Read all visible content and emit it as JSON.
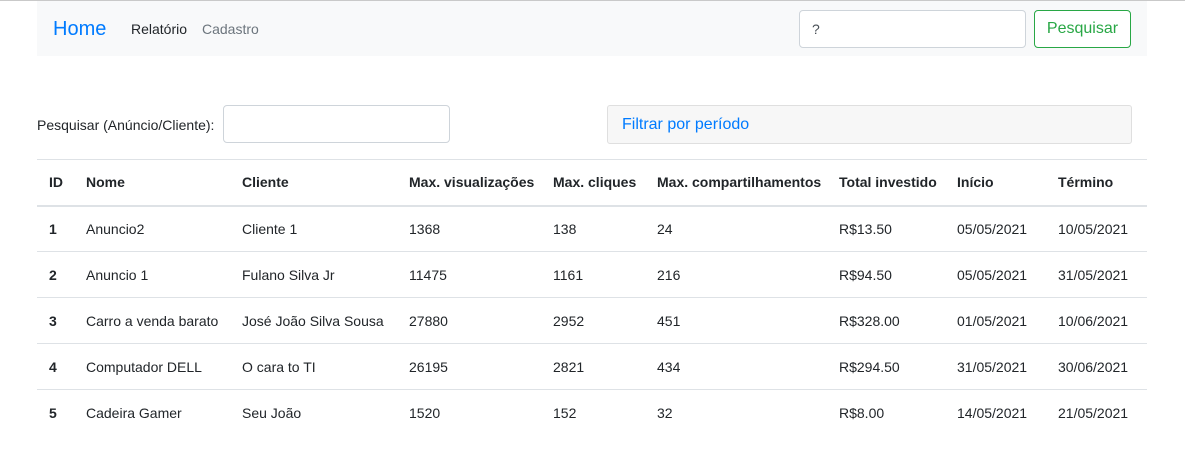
{
  "navbar": {
    "brand": "Home",
    "links": [
      "Relatório",
      "Cadastro"
    ],
    "search_placeholder": "?",
    "search_button": "Pesquisar"
  },
  "filter": {
    "label": "Pesquisar (Anúncio/Cliente):",
    "value": "",
    "period_button": "Filtrar por período"
  },
  "table": {
    "headers": [
      "ID",
      "Nome",
      "Cliente",
      "Max. visualizações",
      "Max. cliques",
      "Max. compartilhamentos",
      "Total investido",
      "Início",
      "Término"
    ],
    "rows": [
      [
        "1",
        "Anuncio2",
        "Cliente 1",
        "1368",
        "138",
        "24",
        "R$13.50",
        "05/05/2021",
        "10/05/2021"
      ],
      [
        "2",
        "Anuncio 1",
        "Fulano Silva Jr",
        "11475",
        "1161",
        "216",
        "R$94.50",
        "05/05/2021",
        "31/05/2021"
      ],
      [
        "3",
        "Carro a venda barato",
        "José João Silva Sousa",
        "27880",
        "2952",
        "451",
        "R$328.00",
        "01/05/2021",
        "10/06/2021"
      ],
      [
        "4",
        "Computador DELL",
        "O cara to TI",
        "26195",
        "2821",
        "434",
        "R$294.50",
        "31/05/2021",
        "30/06/2021"
      ],
      [
        "5",
        "Cadeira Gamer",
        "Seu João",
        "1520",
        "152",
        "32",
        "R$8.00",
        "14/05/2021",
        "21/05/2021"
      ]
    ]
  }
}
